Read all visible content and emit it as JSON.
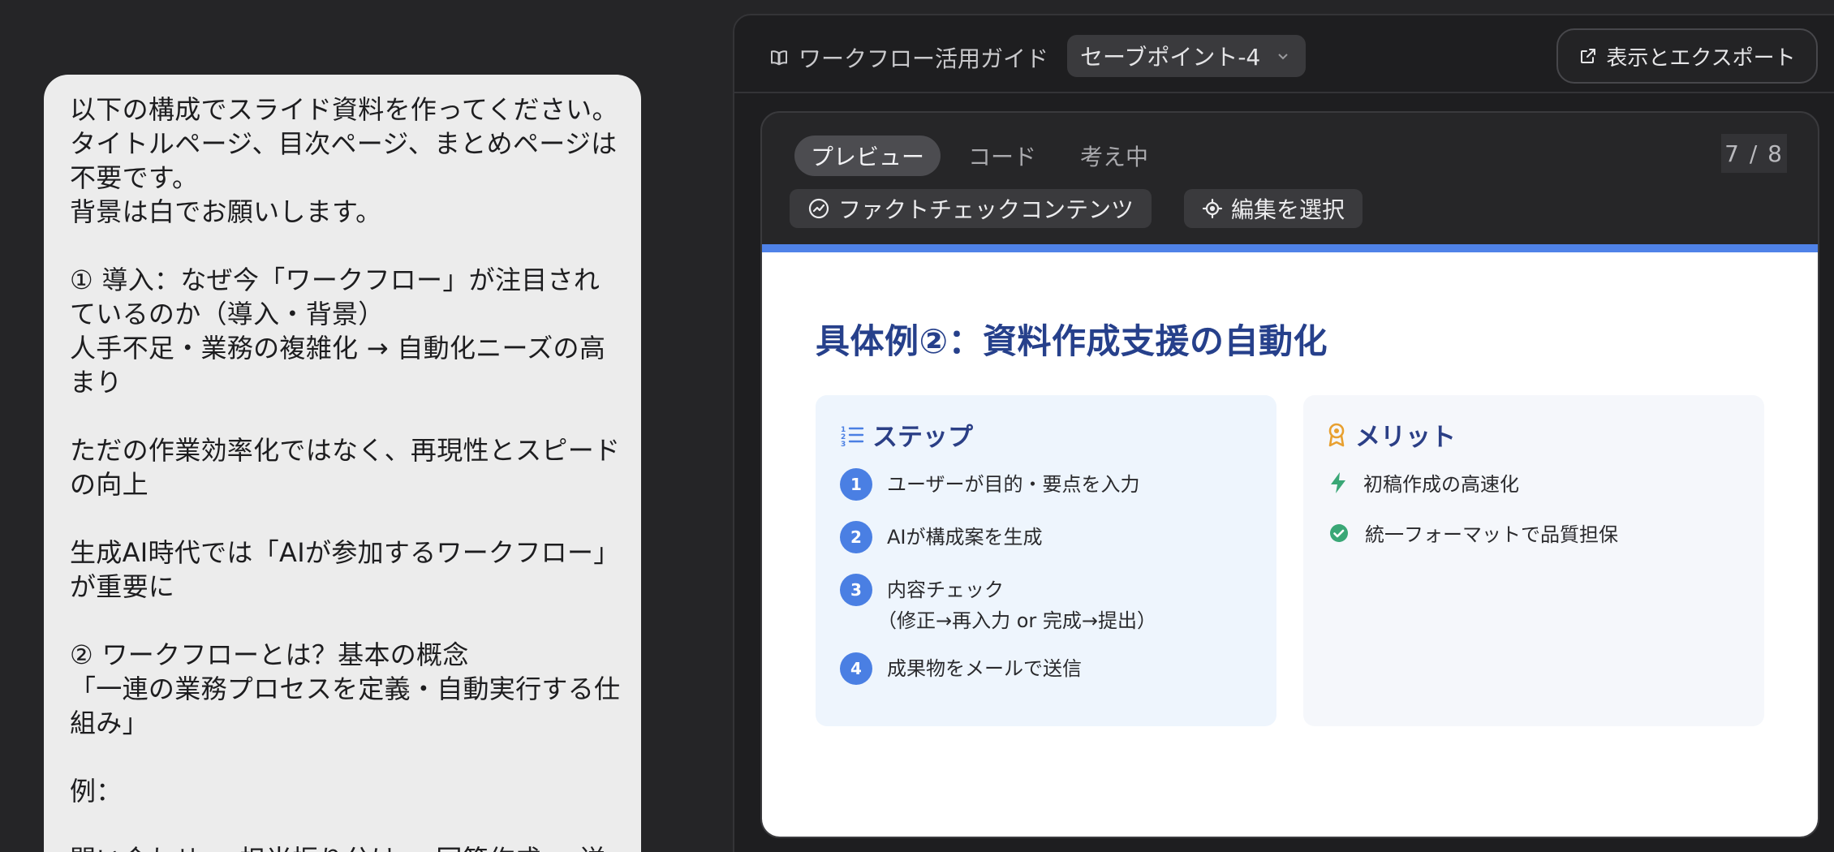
{
  "chat": {
    "user_message_lines": [
      "以下の構成でスライド資料を作ってください。",
      "タイトルページ、目次ページ、まとめページは",
      "不要です。",
      "背景は白でお願いします。",
      "",
      "① 導入：なぜ今「ワークフロー」が注目され",
      "ているのか（導入・背景）",
      "人手不足・業務の複雑化 → 自動化ニーズの高",
      "まり",
      "",
      "ただの作業効率化ではなく、再現性とスピード",
      "の向上",
      "",
      "生成AI時代では「AIが参加するワークフロー」",
      "が重要に",
      "",
      "② ワークフローとは？基本の概念",
      "「一連の業務プロセスを定義・自動実行する仕",
      "組み」",
      "",
      "例：",
      "",
      "問い合わせ → 担当振り分け → 回答作成 → 送"
    ]
  },
  "panel": {
    "doc_title": "ワークフロー活用ガイド",
    "version_label": "セーブポイント-4",
    "export_label": "表示とエクスポート",
    "tabs": [
      "プレビュー",
      "コード",
      "考え中"
    ],
    "page_indicator": "7 / 8",
    "fact_check_label": "ファクトチェックコンテンツ",
    "select_edit_label": "編集を選択"
  },
  "slide": {
    "title": "具体例②：資料作成支援の自動化",
    "steps_card": {
      "title": "ステップ",
      "steps": [
        {
          "num": "1",
          "text": "ユーザーが目的・要点を入力",
          "sub": ""
        },
        {
          "num": "2",
          "text": "AIが構成案を生成",
          "sub": ""
        },
        {
          "num": "3",
          "text": "内容チェック",
          "sub": "（修正→再入力 or 完成→提出）"
        },
        {
          "num": "4",
          "text": "成果物をメールで送信",
          "sub": ""
        }
      ]
    },
    "merits_card": {
      "title": "メリット",
      "merits": [
        "初稿作成の高速化",
        "統一フォーマットで品質担保"
      ]
    }
  },
  "colors": {
    "accent_blue": "#4f82e8",
    "slide_title": "#26408b",
    "step_badge": "#4a7fe3",
    "merit_award": "#e8a030",
    "merit_green": "#3aa776"
  }
}
